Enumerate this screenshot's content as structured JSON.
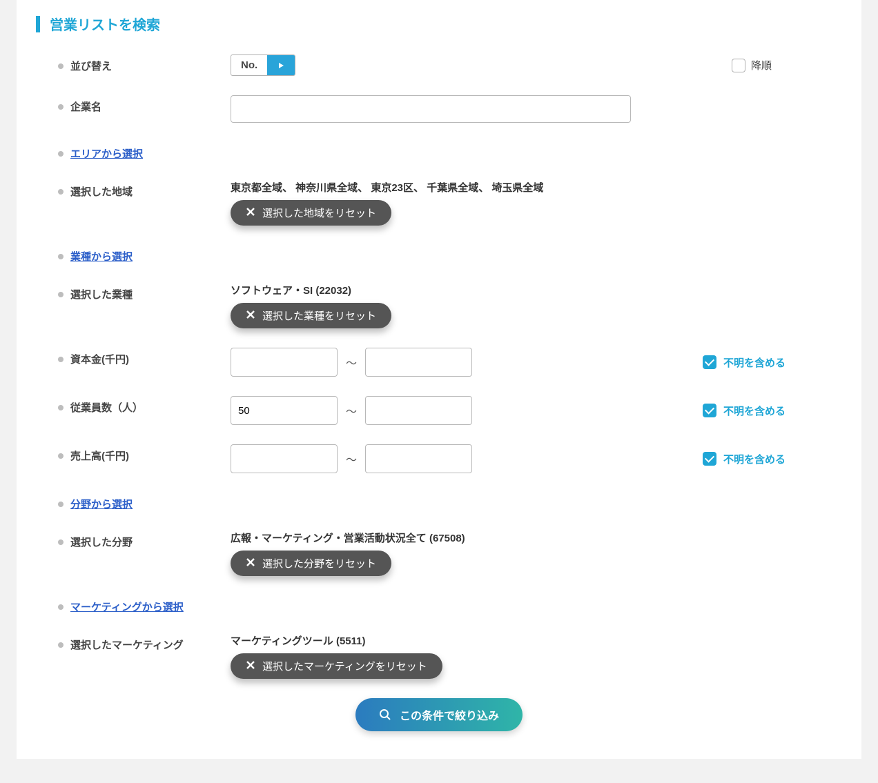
{
  "title": "営業リストを検索",
  "sort": {
    "label": "並び替え",
    "value": "No.",
    "desc_label": "降順"
  },
  "company": {
    "label": "企業名",
    "value": ""
  },
  "area": {
    "link_label": "エリアから選択",
    "selected_label": "選択した地域",
    "selected_text": "東京都全域、 神奈川県全域、 東京23区、 千葉県全域、 埼玉県全域",
    "reset_label": "選択した地域をリセット"
  },
  "industry": {
    "link_label": "業種から選択",
    "selected_label": "選択した業種",
    "selected_text": "ソフトウェア・SI (22032)",
    "reset_label": "選択した業種をリセット"
  },
  "capital": {
    "label": "資本金(千円)",
    "min": "",
    "max": "",
    "unknown_label": "不明を含める"
  },
  "employees": {
    "label": "従業員数（人）",
    "min": "50",
    "max": "",
    "unknown_label": "不明を含める"
  },
  "sales": {
    "label": "売上高(千円)",
    "min": "",
    "max": "",
    "unknown_label": "不明を含める"
  },
  "field": {
    "link_label": "分野から選択",
    "selected_label": "選択した分野",
    "selected_text": "広報・マーケティング・営業活動状況全て (67508)",
    "reset_label": "選択した分野をリセット"
  },
  "marketing": {
    "link_label": "マーケティングから選択",
    "selected_label": "選択したマーケティング",
    "selected_text": "マーケティングツール (5511)",
    "reset_label": "選択したマーケティングをリセット"
  },
  "submit_label": "この条件で絞り込み"
}
